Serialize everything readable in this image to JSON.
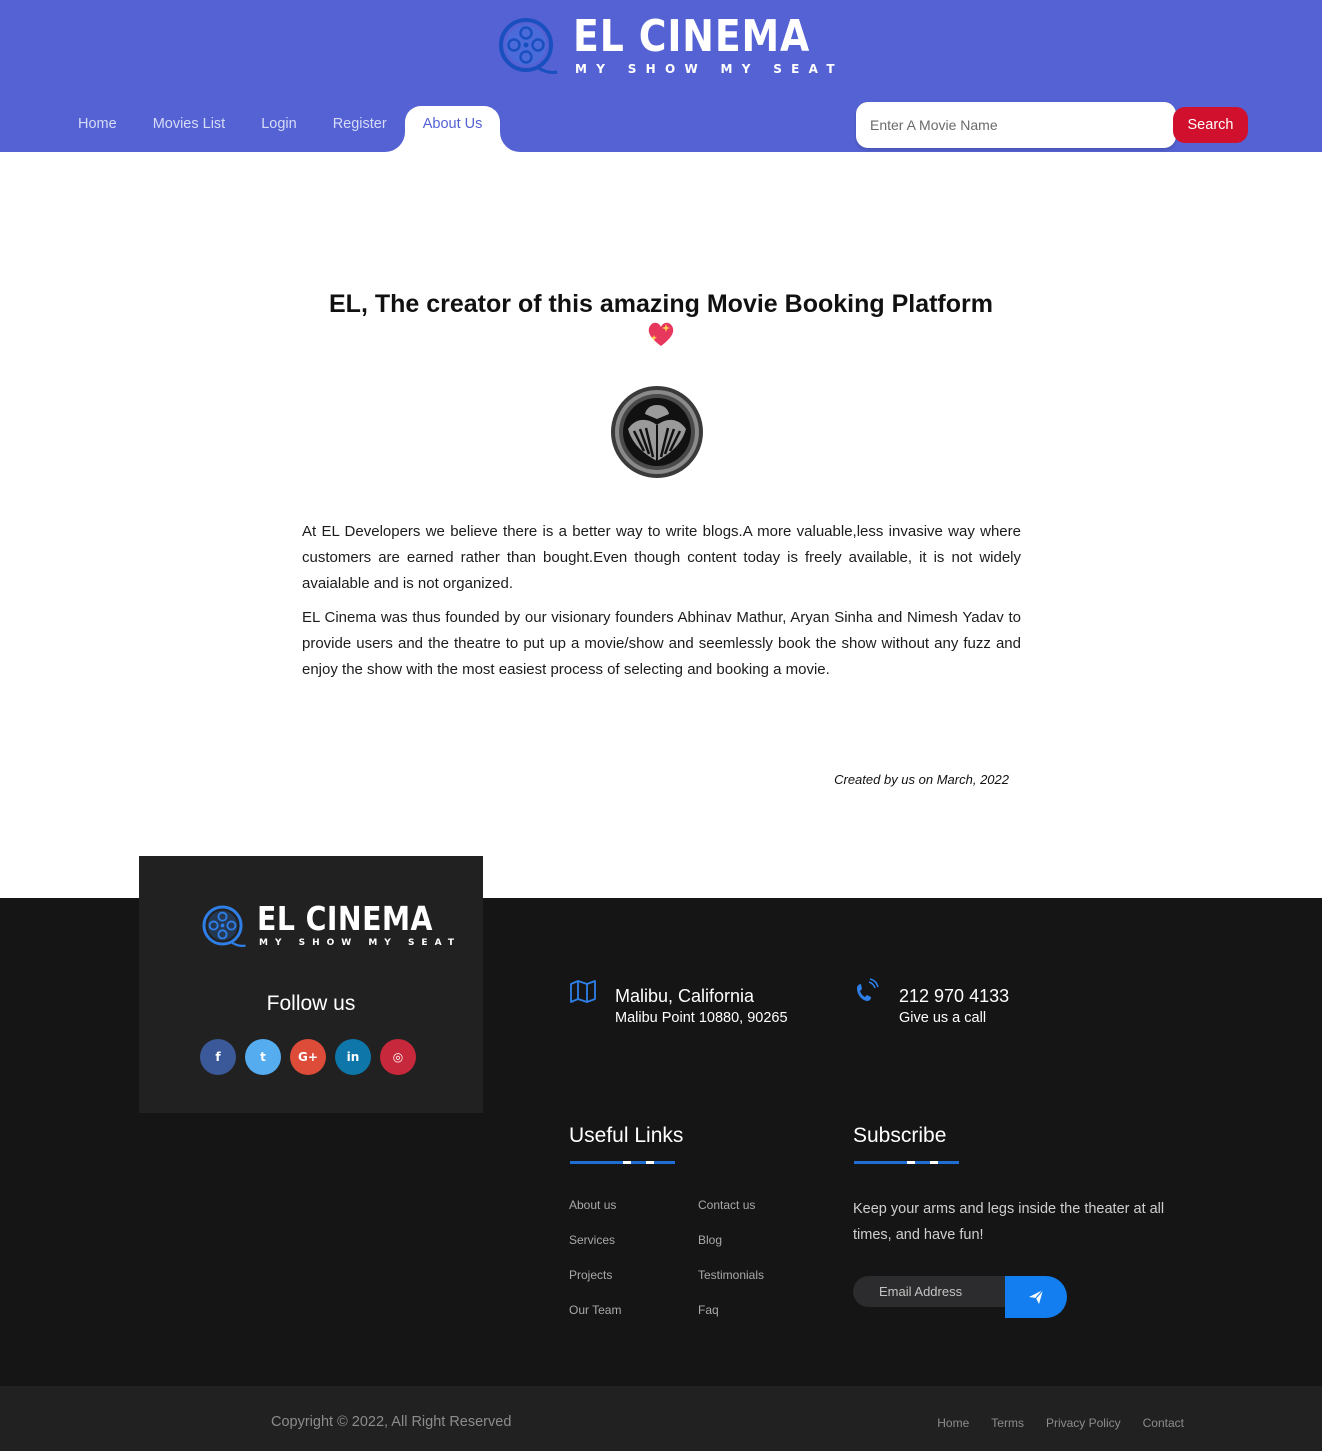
{
  "brand": {
    "name": "EL CINEMA",
    "tagline": "MY SHOW MY SEAT"
  },
  "nav": {
    "items": [
      "Home",
      "Movies List",
      "Login",
      "Register",
      "About Us"
    ],
    "active": "About Us"
  },
  "search": {
    "placeholder": "Enter A Movie Name",
    "value": "",
    "button_label": "Search"
  },
  "main": {
    "title": "EL, The creator of this amazing Movie Booking Platform",
    "paragraph1": "At EL Developers we believe there is a better way to write blogs.A more valuable,less invasive way where customers are earned rather than bought.Even though content today is freely available, it is not widely avaialable and is not organized.",
    "paragraph2": "EL Cinema was thus founded by our visionary founders Abhinav Mathur, Aryan Sinha and Nimesh Yadav to provide users and the theatre to put up a movie/show and seemlessly book the show without any fuzz and enjoy the show with the most easiest process of selecting and booking a movie.",
    "signature": "Created by us on March, 2022"
  },
  "footer": {
    "follow_title": "Follow us",
    "socials": [
      {
        "icon": "facebook-icon",
        "glyph": "f",
        "color": "#3b5998"
      },
      {
        "icon": "twitter-icon",
        "glyph": "t",
        "color": "#55acee"
      },
      {
        "icon": "google-plus-icon",
        "glyph": "G+",
        "color": "#dd4b39"
      },
      {
        "icon": "linkedin-icon",
        "glyph": "in",
        "color": "#0e76a8"
      },
      {
        "icon": "instagram-icon",
        "glyph": "◎",
        "color": "#c7283b"
      }
    ],
    "address": {
      "title": "Malibu, California",
      "detail": "Malibu Point 10880, 90265",
      "icon": "map-icon"
    },
    "phone": {
      "number": "212 970 4133",
      "detail": "Give us a call",
      "icon": "phone-icon"
    },
    "useful_links": {
      "title": "Useful Links",
      "col1": [
        "About us",
        "Services",
        "Projects",
        "Our Team"
      ],
      "col2": [
        "Contact us",
        "Blog",
        "Testimonials",
        "Faq"
      ]
    },
    "subscribe": {
      "title": "Subscribe",
      "text": "Keep your arms and legs inside the theater at all times, and have fun!",
      "placeholder": "Email Address",
      "send_icon": "send-icon"
    },
    "copyright": "Copyright © 2022, All Right Reserved",
    "bottom_links": [
      "Home",
      "Terms",
      "Privacy Policy",
      "Contact"
    ]
  },
  "colors": {
    "header": "#5462d3",
    "search_button": "#d1102e",
    "footer": "#151515",
    "footer_card": "#212121",
    "accent": "#1f6ed4",
    "send_button": "#137ef0"
  }
}
